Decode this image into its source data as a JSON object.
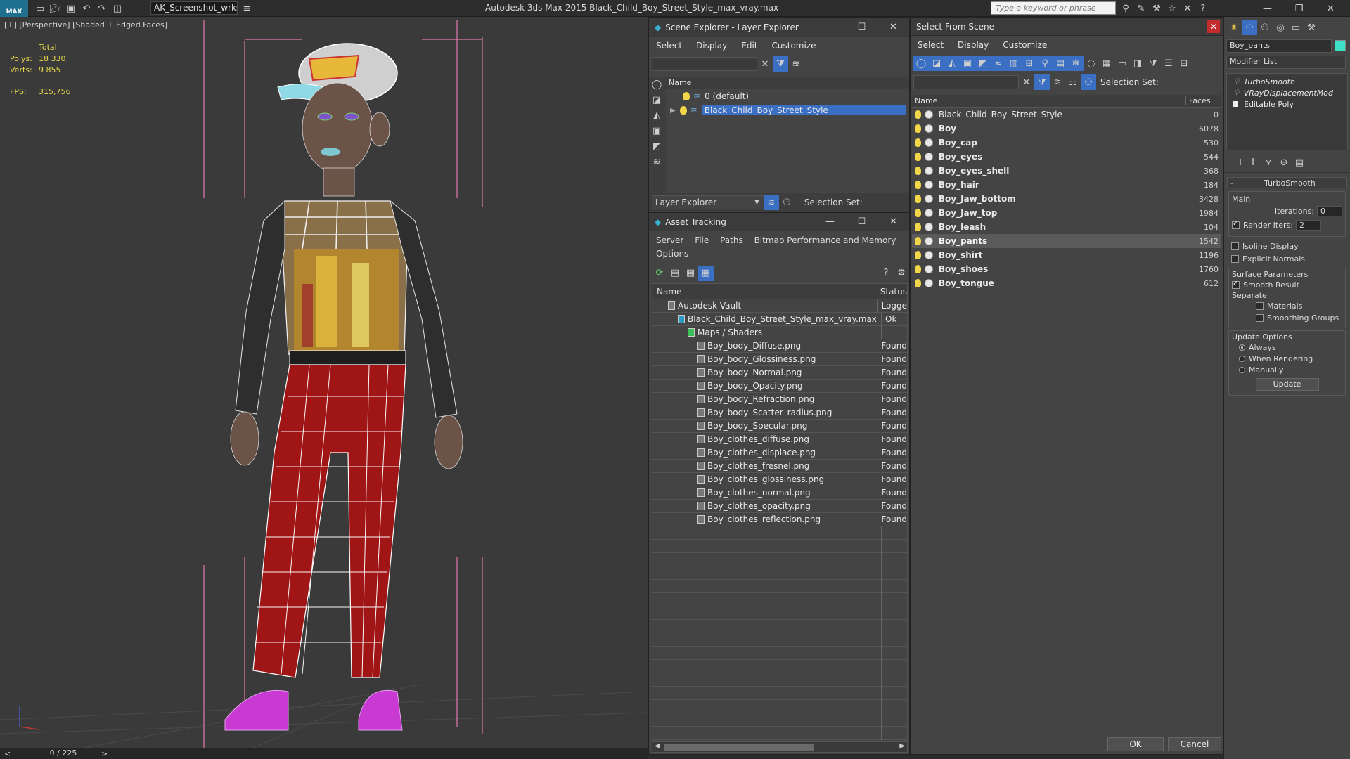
{
  "app": {
    "logo": "MAX",
    "workspace": "AK_Screenshot_wrksp",
    "title": "Autodesk 3ds Max  2015    Black_Child_Boy_Street_Style_max_vray.max",
    "search_placeholder": "Type a keyword or phrase"
  },
  "viewport": {
    "label": "[+] [Perspective] [Shaded + Edged Faces]",
    "stats": {
      "total_label": "Total",
      "polys_label": "Polys:",
      "polys": "18 330",
      "verts_label": "Verts:",
      "verts": "9 855",
      "fps_label": "FPS:",
      "fps": "315,756"
    },
    "frame_counter": "0 / 225"
  },
  "scene_explorer": {
    "title": "Scene Explorer - Layer Explorer",
    "menu": [
      "Select",
      "Display",
      "Edit",
      "Customize"
    ],
    "column_name": "Name",
    "layers": [
      "0 (default)",
      "Black_Child_Boy_Street_Style"
    ],
    "footer_dropdown": "Layer Explorer",
    "selection_set_label": "Selection Set:"
  },
  "asset_tracking": {
    "title": "Asset Tracking",
    "menu": [
      "Server",
      "File",
      "Paths",
      "Bitmap Performance and Memory",
      "Options"
    ],
    "col_name": "Name",
    "col_status": "Status",
    "rows": [
      {
        "name": "Autodesk Vault",
        "status": "Logge",
        "indent": 1
      },
      {
        "name": "Black_Child_Boy_Street_Style_max_vray.max",
        "status": "Ok",
        "indent": 2
      },
      {
        "name": "Maps / Shaders",
        "status": "",
        "indent": 3
      },
      {
        "name": "Boy_body_Diffuse.png",
        "status": "Found",
        "indent": 4
      },
      {
        "name": "Boy_body_Glossiness.png",
        "status": "Found",
        "indent": 4
      },
      {
        "name": "Boy_body_Normal.png",
        "status": "Found",
        "indent": 4
      },
      {
        "name": "Boy_body_Opacity.png",
        "status": "Found",
        "indent": 4
      },
      {
        "name": "Boy_body_Refraction.png",
        "status": "Found",
        "indent": 4
      },
      {
        "name": "Boy_body_Scatter_radius.png",
        "status": "Found",
        "indent": 4
      },
      {
        "name": "Boy_body_Specular.png",
        "status": "Found",
        "indent": 4
      },
      {
        "name": "Boy_clothes_diffuse.png",
        "status": "Found",
        "indent": 4
      },
      {
        "name": "Boy_clothes_displace.png",
        "status": "Found",
        "indent": 4
      },
      {
        "name": "Boy_clothes_fresnel.png",
        "status": "Found",
        "indent": 4
      },
      {
        "name": "Boy_clothes_glossiness.png",
        "status": "Found",
        "indent": 4
      },
      {
        "name": "Boy_clothes_normal.png",
        "status": "Found",
        "indent": 4
      },
      {
        "name": "Boy_clothes_opacity.png",
        "status": "Found",
        "indent": 4
      },
      {
        "name": "Boy_clothes_reflection.png",
        "status": "Found",
        "indent": 4
      }
    ]
  },
  "select_from_scene": {
    "title": "Select From Scene",
    "menu": [
      "Select",
      "Display",
      "Customize"
    ],
    "selection_set_label": "Selection Set:",
    "col_name": "Name",
    "col_faces": "Faces",
    "objects": [
      {
        "name": "Black_Child_Boy_Street_Style",
        "faces": "0",
        "bold": false,
        "selected": false
      },
      {
        "name": "Boy",
        "faces": "6078",
        "bold": true,
        "selected": false
      },
      {
        "name": "Boy_cap",
        "faces": "530",
        "bold": true,
        "selected": false
      },
      {
        "name": "Boy_eyes",
        "faces": "544",
        "bold": true,
        "selected": false
      },
      {
        "name": "Boy_eyes_shell",
        "faces": "368",
        "bold": true,
        "selected": false
      },
      {
        "name": "Boy_hair",
        "faces": "184",
        "bold": true,
        "selected": false
      },
      {
        "name": "Boy_Jaw_bottom",
        "faces": "3428",
        "bold": true,
        "selected": false
      },
      {
        "name": "Boy_Jaw_top",
        "faces": "1984",
        "bold": true,
        "selected": false
      },
      {
        "name": "Boy_leash",
        "faces": "104",
        "bold": true,
        "selected": false
      },
      {
        "name": "Boy_pants",
        "faces": "1542",
        "bold": true,
        "selected": true
      },
      {
        "name": "Boy_shirt",
        "faces": "1196",
        "bold": true,
        "selected": false
      },
      {
        "name": "Boy_shoes",
        "faces": "1760",
        "bold": true,
        "selected": false
      },
      {
        "name": "Boy_tongue",
        "faces": "612",
        "bold": true,
        "selected": false
      }
    ],
    "ok": "OK",
    "cancel": "Cancel"
  },
  "command_panel": {
    "object_name": "Boy_pants",
    "modifier_list": "Modifier List",
    "stack": [
      "TurboSmooth",
      "VRayDisplacementMod",
      "Editable Poly"
    ],
    "rollout_title": "TurboSmooth",
    "main_label": "Main",
    "iterations_label": "Iterations:",
    "iterations": "0",
    "render_iters_label": "Render Iters:",
    "render_iters": "2",
    "isoline_label": "Isoline Display",
    "explicit_normals_label": "Explicit Normals",
    "surface_params_label": "Surface Parameters",
    "smooth_result_label": "Smooth Result",
    "separate_label": "Separate",
    "materials_label": "Materials",
    "smoothing_groups_label": "Smoothing Groups",
    "update_options_label": "Update Options",
    "always_label": "Always",
    "when_rendering_label": "When Rendering",
    "manually_label": "Manually",
    "update_button": "Update"
  },
  "colors": {
    "selection_blue": "#3a6fc4",
    "stat_yellow": "#e8d84a",
    "pants_red": "#a01515"
  }
}
